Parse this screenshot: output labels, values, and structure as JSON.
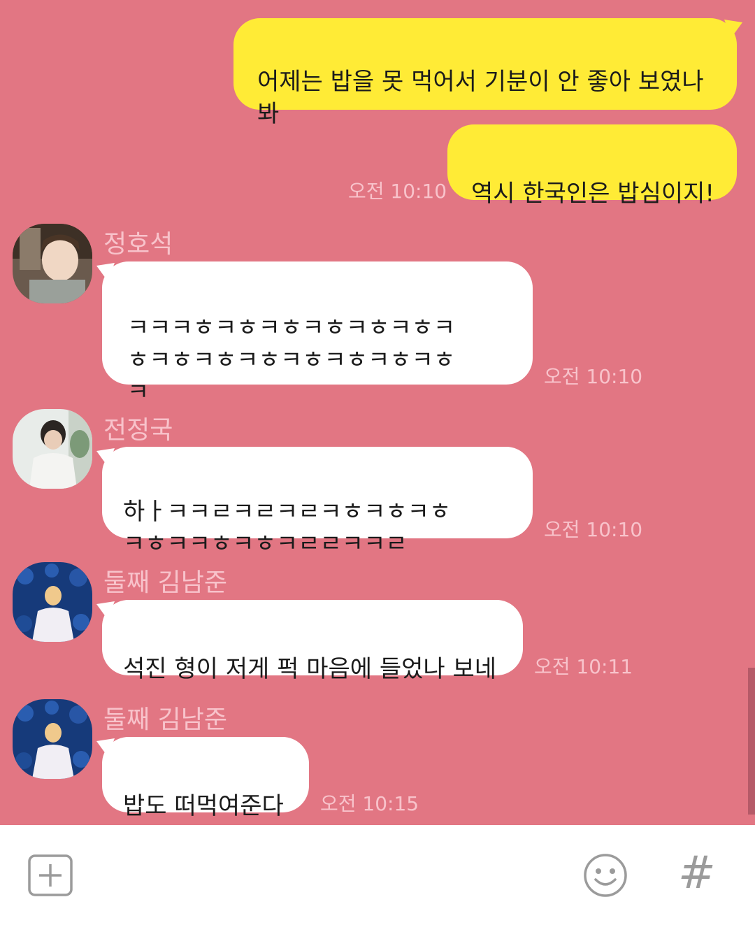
{
  "messages": {
    "m1": {
      "text": "어제는 밥을 못 먹어서 기분이 안 좋아 보였나\n봐"
    },
    "m2": {
      "text": "역시 한국인은 밥심이지!",
      "time": "오전 10:10"
    },
    "m3": {
      "sender": "정호석",
      "text": "ㅋㅋㅋㅎㅋㅎㅋㅎㅋㅎㅋㅎㅋㅎㅋ\nㅎㅋㅎㅋㅎㅋㅎㅋㅎㅋㅎㅋㅎㅋㅎ\nㅋ",
      "time": "오전 10:10"
    },
    "m4": {
      "sender": "전정국",
      "text": "하ㅏㅋㅋㄹㅋㄹㅋㄹㅋㅎㅋㅎㅋㅎ\nㅋㅎㅋㅋㅎㅋㅎㅋㄹㄹㅋㅋㄹ",
      "time": "오전 10:10"
    },
    "m5": {
      "sender": "둘째 김남준",
      "text": "석진 형이 저게 퍽 마음에 들었나 보네",
      "time": "오전 10:11"
    },
    "m6": {
      "sender": "둘째 김남준",
      "text": "밥도 떠먹여준다",
      "time": "오전 10:15"
    }
  },
  "input_bar": {
    "add_icon": "plus-square-icon",
    "emoji_icon": "smiley-icon",
    "hashtag_icon": "hash-icon",
    "hashtag_label": "#"
  },
  "colors": {
    "background": "#e27683",
    "my_bubble": "#ffeb36",
    "their_bubble": "#ffffff",
    "meta_text": "#f8c3cb"
  }
}
